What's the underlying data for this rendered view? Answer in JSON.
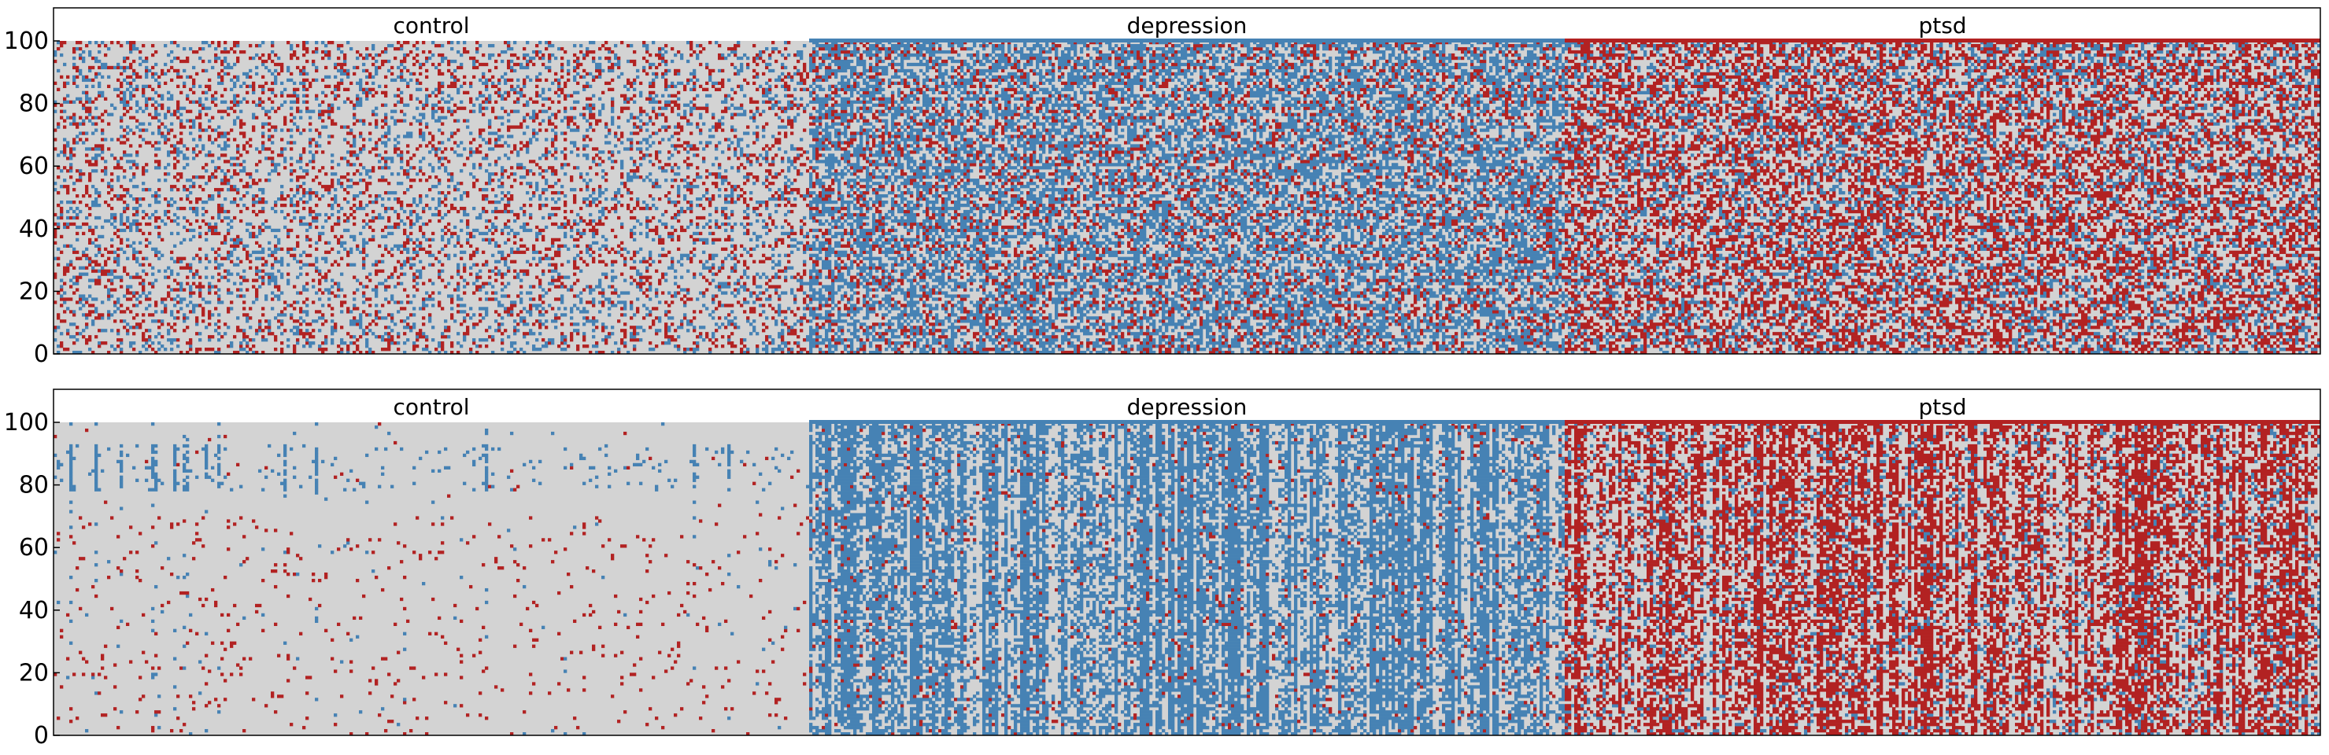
{
  "chart_data": [
    {
      "type": "heatmap",
      "panel": "top",
      "groups": [
        {
          "name": "control",
          "color": "#d3d3d3",
          "red_rate": 0.14,
          "blue_rate": 0.14,
          "pattern": "sparse"
        },
        {
          "name": "depression",
          "color": "#4682b4",
          "red_rate": 0.16,
          "blue_rate": 0.45,
          "pattern": "dense"
        },
        {
          "name": "ptsd",
          "color": "#b22222",
          "red_rate": 0.36,
          "blue_rate": 0.2,
          "pattern": "dense"
        }
      ],
      "ylim": [
        0,
        100
      ],
      "yticks": [
        "0",
        "20",
        "40",
        "60",
        "80",
        "100"
      ],
      "grid": false
    },
    {
      "type": "heatmap",
      "panel": "bottom",
      "groups": [
        {
          "name": "control",
          "color": "#d3d3d3",
          "red_rate": 0.02,
          "blue_rate": 0.03,
          "pattern": "very sparse"
        },
        {
          "name": "depression",
          "color": "#4682b4",
          "red_rate": 0.04,
          "blue_rate": 0.5,
          "pattern": "vertical stripes"
        },
        {
          "name": "ptsd",
          "color": "#b22222",
          "red_rate": 0.42,
          "blue_rate": 0.1,
          "pattern": "vertical stripes"
        }
      ],
      "ylim": [
        0,
        100
      ],
      "yticks": [
        "0",
        "20",
        "40",
        "60",
        "80",
        "100"
      ],
      "grid": false
    }
  ],
  "colors": {
    "background": "#d3d3d3",
    "blue": "#4682b4",
    "red": "#b22222"
  }
}
